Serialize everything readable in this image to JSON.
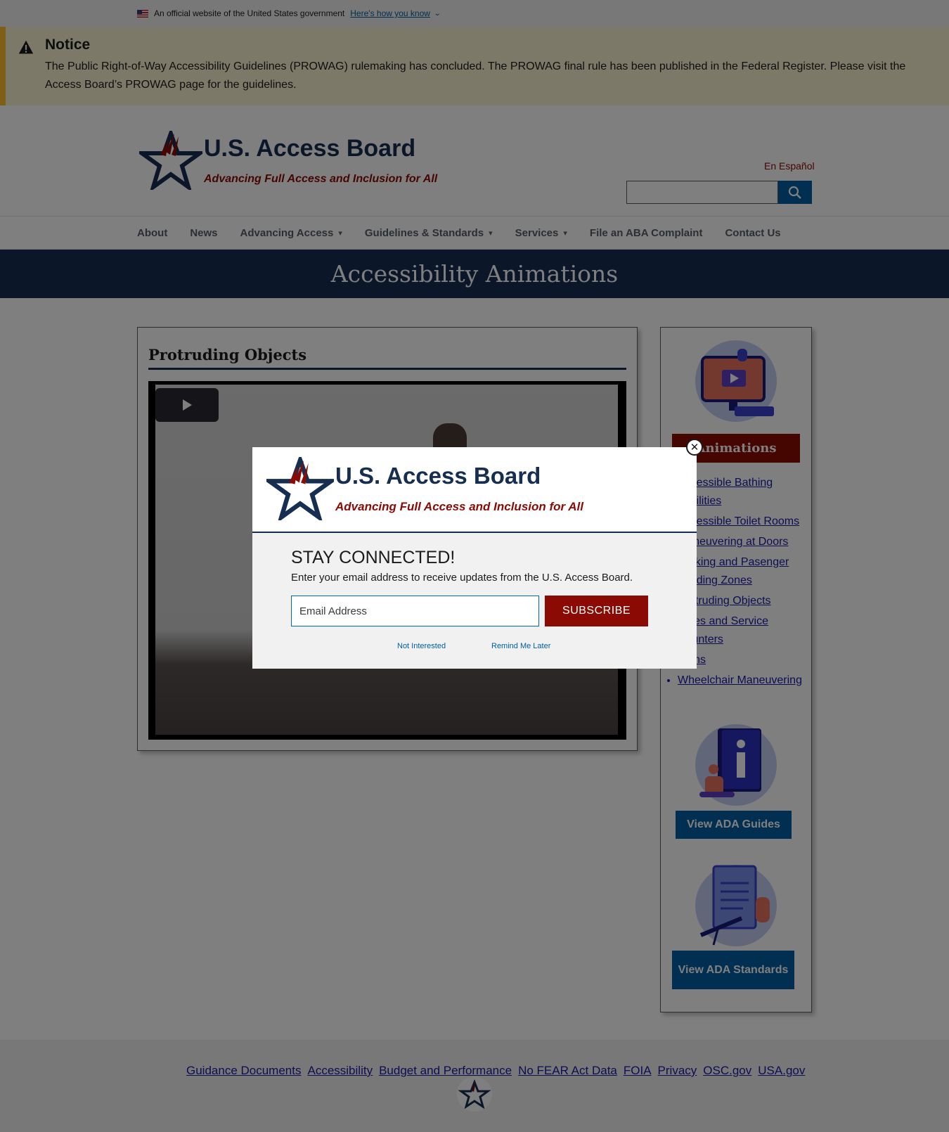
{
  "gov_banner": {
    "text": "An official website of the United States government",
    "link": "Here's how you know"
  },
  "notice": {
    "title": "Notice",
    "text": "The Public Right-of-Way Accessibility Guidelines (PROWAG) rulemaking has concluded. The PROWAG final rule has been published in the Federal Register. Please visit the Access Board’s PROWAG page for the guidelines."
  },
  "header": {
    "title": "U.S. Access Board",
    "tagline": "Advancing Full Access and Inclusion for All",
    "language_link": "En Español"
  },
  "nav": {
    "items": [
      {
        "label": "About"
      },
      {
        "label": "News"
      },
      {
        "label": "Advancing Access"
      },
      {
        "label": "Guidelines & Standards"
      },
      {
        "label": "Services"
      },
      {
        "label": "File an ABA Complaint"
      },
      {
        "label": "Contact Us"
      }
    ]
  },
  "hero": {
    "title": "Accessibility Animations"
  },
  "main": {
    "title": "Protruding Objects"
  },
  "sidebar": {
    "header": "Animations",
    "links": [
      "Accessible Bathing Facilities",
      "Accessible Toilet Rooms",
      "Maneuvering at Doors",
      "Parking and Pasenger Loading Zones",
      "Protruding Objects",
      "Sales and Service Counters",
      "Signs",
      "Wheelchair Maneuvering"
    ],
    "guides_button": "View ADA Guides",
    "standards_button": "View ADA Standards",
    "colors": {
      "accent": "#8b0a03",
      "button": "#005ea2"
    }
  },
  "footer": {
    "links": [
      "Guidance Documents",
      "Accessibility",
      "Budget and Performance",
      "No FEAR Act Data",
      "FOIA",
      "Privacy",
      "OSC.gov",
      "USA.gov"
    ]
  },
  "modal": {
    "title": "U.S. Access Board",
    "tagline": "Advancing Full Access and Inclusion for All",
    "heading": "STAY CONNECTED!",
    "description": "Enter your email address to receive updates from the U.S. Access Board.",
    "email_placeholder": "Email Address",
    "subscribe_label": "SUBSCRIBE",
    "not_interested": "Not Interested",
    "remind_later": "Remind Me Later"
  }
}
